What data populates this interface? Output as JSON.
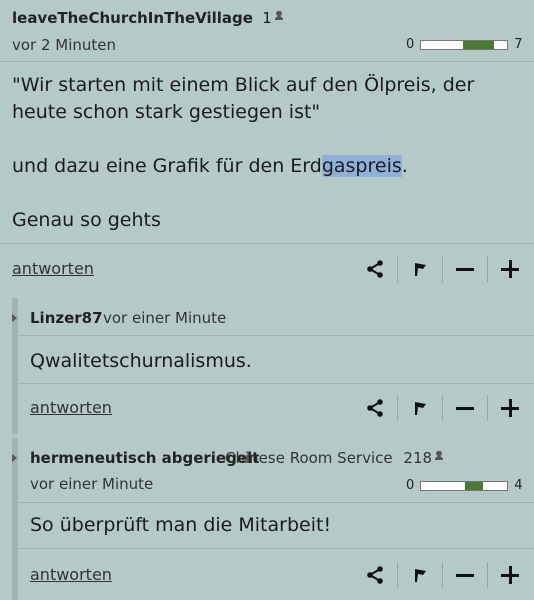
{
  "posting": {
    "username": "leaveTheChurchInTheVillage",
    "follower_count": "1",
    "timestamp": "vor 2 Minuten",
    "rating_negative": "0",
    "rating_positive": "7",
    "rating_fraction": 0.35,
    "paragraphs": [
      "\"Wir starten mit einem Blick auf den Ölpreis, der heute schon stark gestiegen ist\"",
      "und dazu eine Grafik für den Erdgaspreis.",
      "Genau so gehts"
    ],
    "para2_before": "und dazu eine Grafik für den Erd",
    "para2_highlight": "gaspreis",
    "para2_after": ".",
    "reply_label": "antworten"
  },
  "replies": [
    {
      "username": "Linzer87",
      "timestamp": "vor einer Minute",
      "text": "Qwalitetschurnalismus.",
      "reply_label": "antworten"
    },
    {
      "username": "hermeneutisch abgeriegelt",
      "community": "Chinese Room Service",
      "follower_count": "218",
      "timestamp": "vor einer Minute",
      "rating_negative": "0",
      "rating_positive": "4",
      "rating_fraction": 0.2,
      "text": "So überprüft man die Mitarbeit!",
      "reply_label": "antworten"
    }
  ],
  "icons": [
    "person-icon",
    "share-icon",
    "flag-icon",
    "minus-icon",
    "plus-icon",
    "expand-arrow-icon"
  ],
  "colors": {
    "background": "#b5cac8",
    "rating_fill": "#4a7b30",
    "highlight": "#8fb0d8"
  }
}
